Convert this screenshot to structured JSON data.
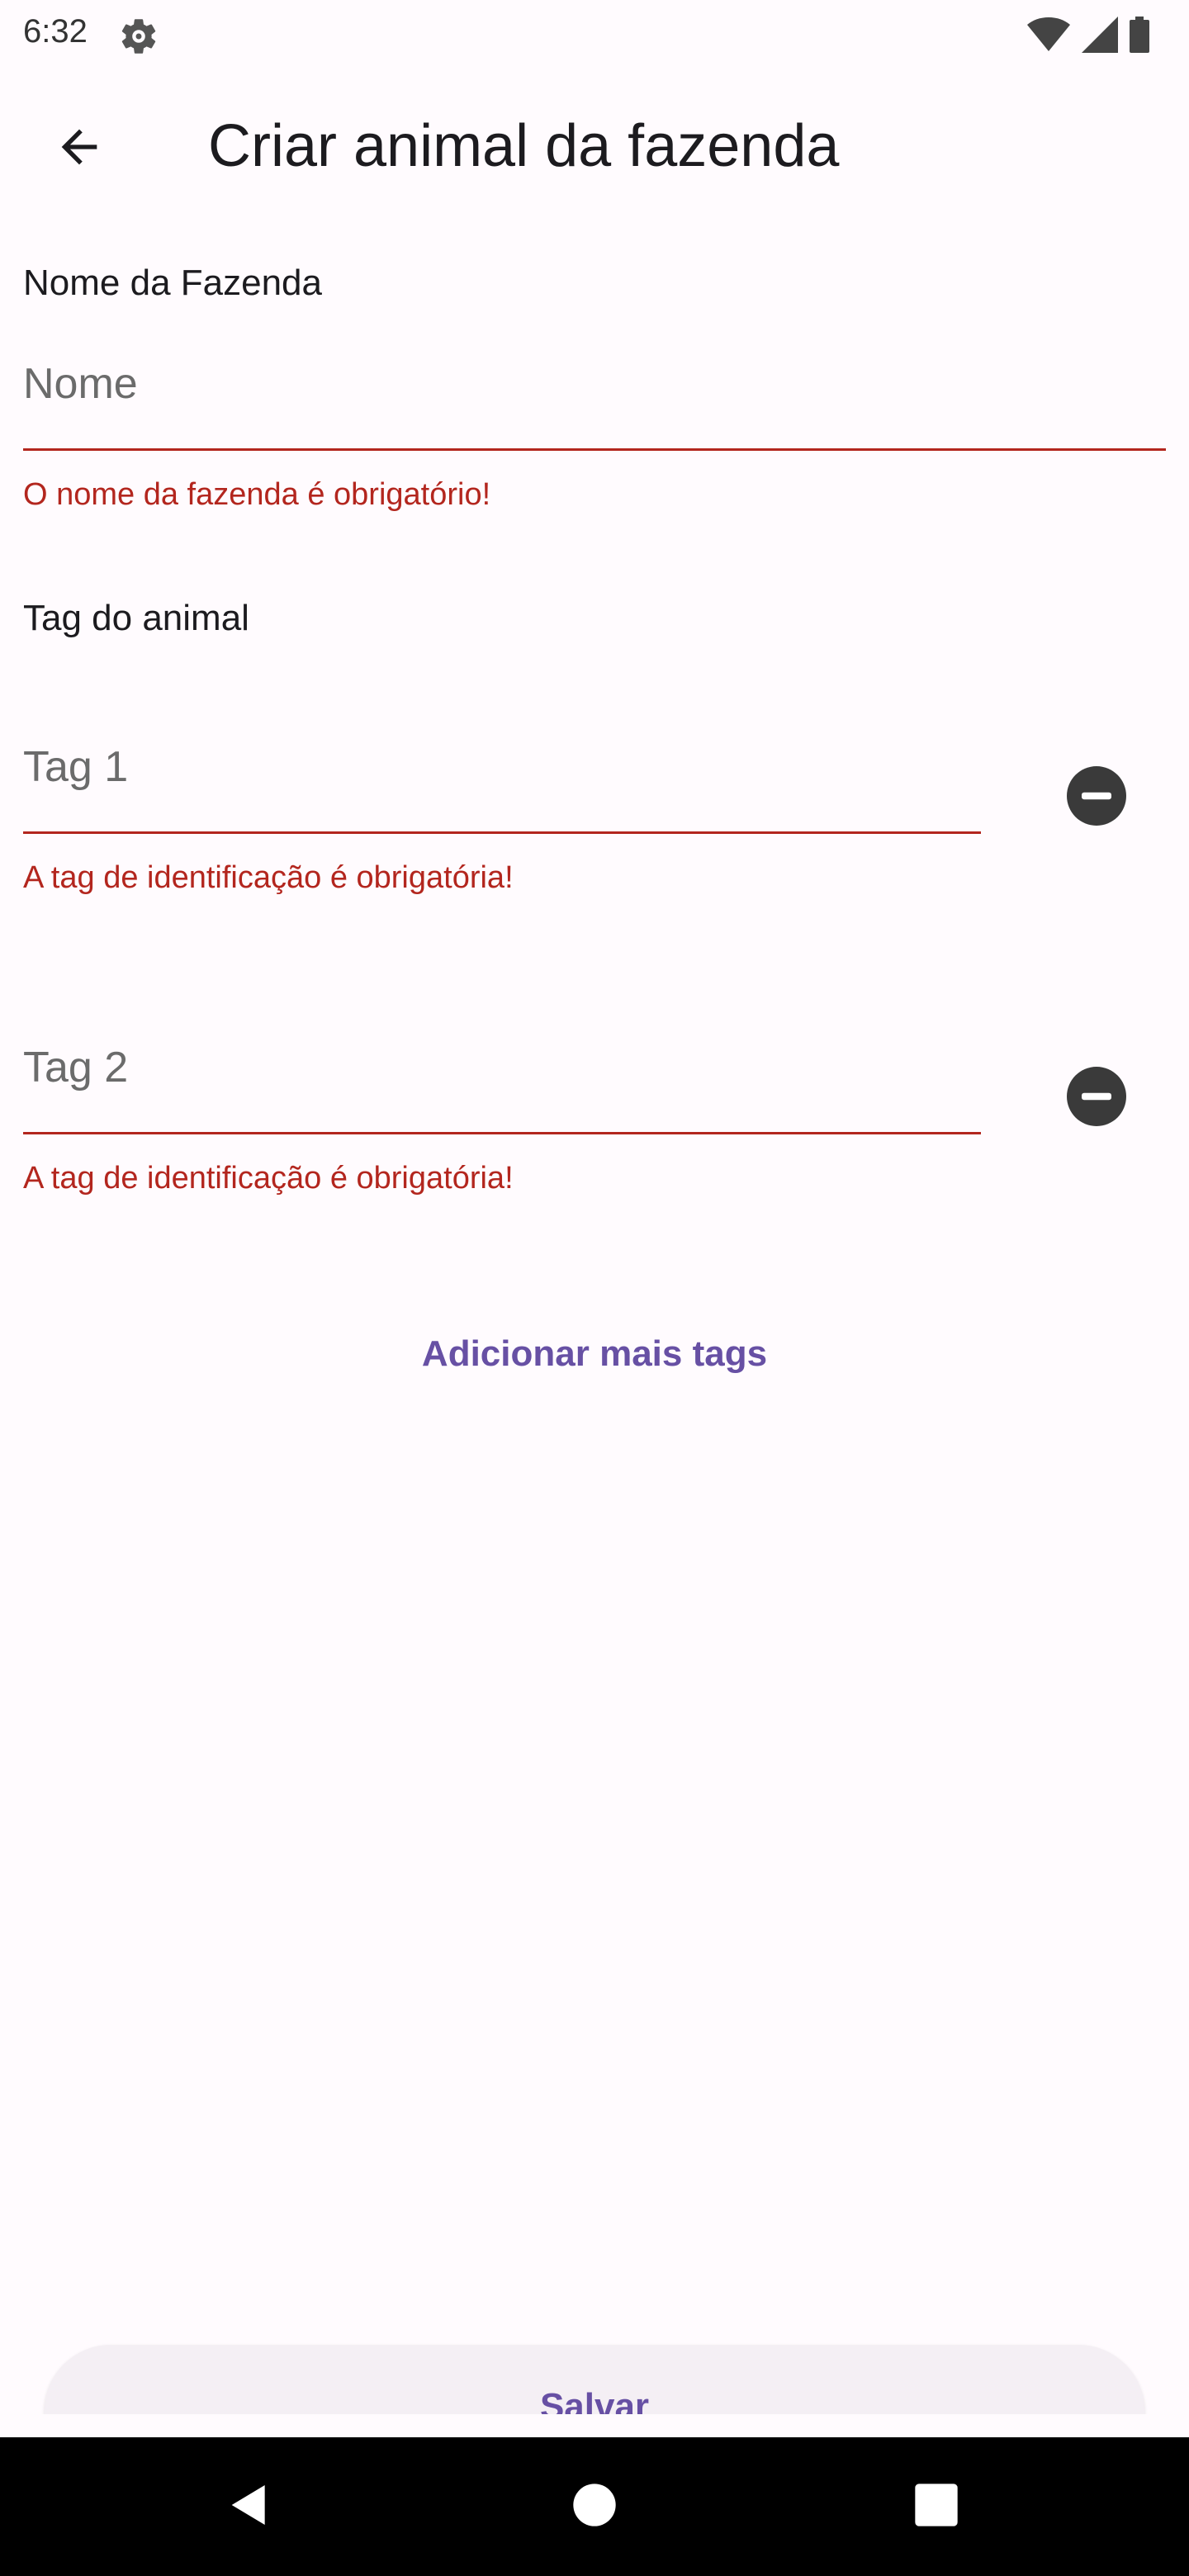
{
  "status_bar": {
    "time": "6:32",
    "icons": [
      "gear-icon",
      "wifi-icon",
      "signal-icon",
      "battery-icon"
    ]
  },
  "app_bar": {
    "title": "Criar animal da fazenda",
    "back_icon": "arrow-back-icon"
  },
  "farm": {
    "label": "Nome da Fazenda",
    "placeholder": "Nome",
    "value": "",
    "error": "O nome da fazenda é obrigatório!"
  },
  "tags": {
    "label": "Tag do animal",
    "items": [
      {
        "placeholder": "Tag 1",
        "value": "",
        "error": "A tag de identificação é obrigatória!",
        "remove_icon": "remove-circle-icon"
      },
      {
        "placeholder": "Tag 2",
        "value": "",
        "error": "A tag de identificação é obrigatória!",
        "remove_icon": "remove-circle-icon"
      }
    ],
    "add_button": "Adicionar mais tags"
  },
  "save_button": "Salvar",
  "nav_bar": {
    "icons": [
      "back-triangle-icon",
      "home-circle-icon",
      "recents-square-icon"
    ]
  },
  "colors": {
    "error": "#b3261e",
    "primary": "#6750a4",
    "background": "#fffbfe",
    "icon_dark": "#3a3a3a"
  }
}
